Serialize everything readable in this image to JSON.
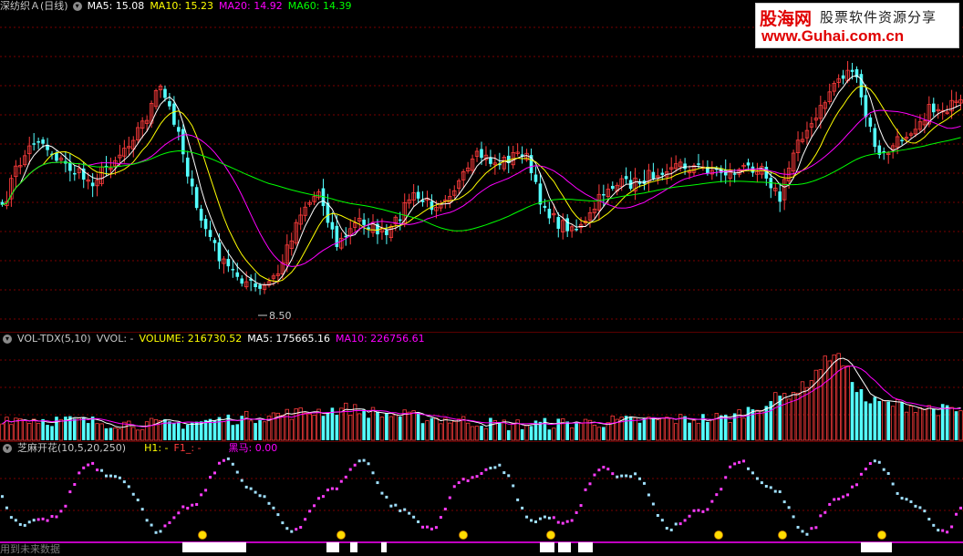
{
  "price_pane": {
    "title": "深纺织Ａ(日线)",
    "ma5": "MA5: 15.08",
    "ma10": "MA10: 15.23",
    "ma20": "MA20: 14.92",
    "ma60": "MA60: 14.39",
    "low_label": "8.50"
  },
  "volume_pane": {
    "title": "VOL-TDX(5,10)",
    "vvol": "VVOL: -",
    "volume": "VOLUME: 216730.52",
    "ma5": "MA5: 175665.16",
    "ma10": "MA10: 226756.61"
  },
  "indicator_pane": {
    "title": "芝麻开花(10,5,20,250)",
    "h1": "H1: -",
    "f1": "F1_: -",
    "heima": "黑马: 0.00"
  },
  "watermark": {
    "brand": "股海网",
    "slogan": "股票软件资源分享",
    "url": "www.Guhai.com.cn"
  },
  "footer": {
    "text": "用到未来数据"
  },
  "colors": {
    "up": "#ff3c3c",
    "down": "#54ffff",
    "ma5": "#ffffff",
    "ma10": "#ffff00",
    "ma20": "#ff00ff",
    "ma60": "#00ff00",
    "grid": "#7a0000"
  }
}
